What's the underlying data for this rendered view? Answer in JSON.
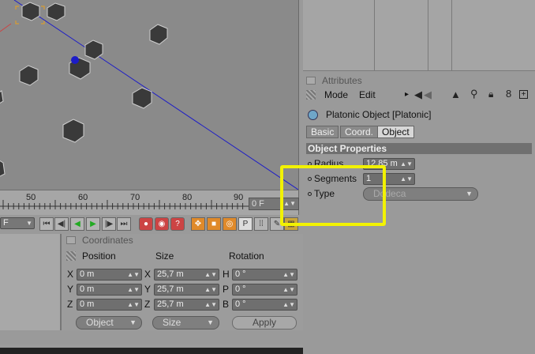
{
  "timeline": {
    "ruler": [
      "50",
      "60",
      "70",
      "80",
      "90"
    ],
    "frame": "0 F"
  },
  "transport": {
    "left_field": "F",
    "buttons": [
      "first-frame",
      "prev-key",
      "play-back",
      "play-forward",
      "next-key",
      "last-frame",
      "record",
      "autokey",
      "keyframe-help",
      "move",
      "scale",
      "rotate",
      "param",
      "points",
      "settings"
    ]
  },
  "coordinates": {
    "title": "Coordinates",
    "headers": {
      "position": "Position",
      "size": "Size",
      "rotation": "Rotation"
    },
    "rows": [
      {
        "p_axis": "X",
        "p_val": "0 m",
        "s_axis": "X",
        "s_val": "25,7 m",
        "r_axis": "H",
        "r_val": "0 °"
      },
      {
        "p_axis": "Y",
        "p_val": "0 m",
        "s_axis": "Y",
        "s_val": "25,7 m",
        "r_axis": "P",
        "r_val": "0 °"
      },
      {
        "p_axis": "Z",
        "p_val": "0 m",
        "s_axis": "Z",
        "s_val": "25,7 m",
        "r_axis": "B",
        "r_val": "0 °"
      }
    ],
    "mode_dropdown": "Object",
    "size_dropdown": "Size",
    "apply": "Apply"
  },
  "attributes": {
    "title": "Attributes",
    "menu": {
      "mode": "Mode",
      "edit": "Edit"
    },
    "object_title": "Platonic Object [Platonic]",
    "tabs": [
      "Basic",
      "Coord.",
      "Object"
    ],
    "active_tab": "Object",
    "section": "Object Properties",
    "radius": {
      "label": "Radius",
      "value": "12,85 m"
    },
    "segments": {
      "label": "Segments",
      "value": "1"
    },
    "type": {
      "label": "Type",
      "value": "Dodeca"
    }
  },
  "colors": {
    "highlight": "#f2f200",
    "axis_blue": "#1c1cc8",
    "selection_orange": "#e8a020"
  }
}
